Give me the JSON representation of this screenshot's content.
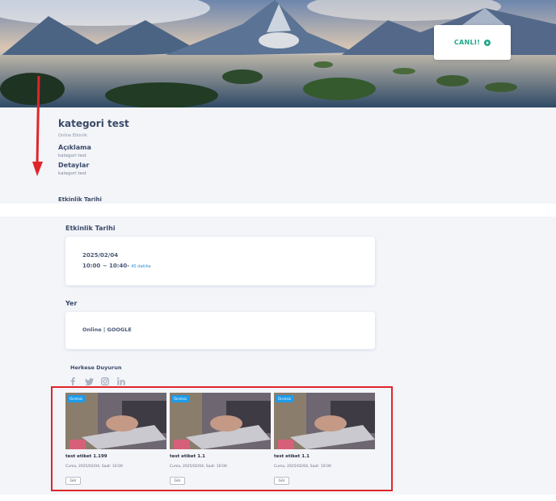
{
  "hero": {
    "live_label": "CANLI!"
  },
  "event": {
    "title": "kategori test",
    "subtitle": "Online Etkinlik",
    "description_heading": "Açıklama",
    "description_text": "kategori test",
    "details_heading": "Detaylar",
    "details_text": "kategori test",
    "date_heading_top": "Etkinlik Tarihi"
  },
  "lower": {
    "date_heading": "Etkinlik Tarihi",
    "date": "2025/02/04",
    "time": "10:00 ~ 10:40-",
    "duration": "40 dakika",
    "location_heading": "Yer",
    "location": "Online | GOOGLE",
    "share_heading": "Herkese Duyurun",
    "social_icons": [
      "facebook-icon",
      "twitter-icon",
      "instagram-icon",
      "linkedin-icon"
    ]
  },
  "related_events": [
    {
      "badge": "Ücretsiz",
      "name": "test etiket 1.199",
      "when": "Cuma, 2025/02/04, Saat: 10:00",
      "button": "Gör"
    },
    {
      "badge": "Ücretsiz",
      "name": "test etiket 1.1",
      "when": "Cuma, 2025/02/04, Saat: 10:00",
      "button": "Gör"
    },
    {
      "badge": "Ücretsiz",
      "name": "test etiket 1.1",
      "when": "Cuma, 2025/02/04, Saat: 10:00",
      "button": "Gör"
    }
  ],
  "colors": {
    "accent_live": "#1fa88a",
    "highlight_red": "#e0252b",
    "badge_blue": "#1e9be8",
    "heading": "#3a4a68"
  }
}
